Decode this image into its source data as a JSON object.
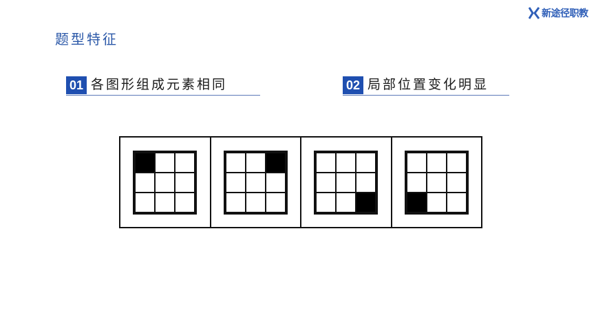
{
  "brand": {
    "logo_text": "新途径职教",
    "icon": "x-logo-icon",
    "color": "#2f5fb8"
  },
  "title": "题型特征",
  "points": [
    {
      "num": "01",
      "label": "各图形组成元素相同"
    },
    {
      "num": "02",
      "label": "局部位置变化明显"
    }
  ],
  "figures": [
    {
      "filled": [
        0
      ]
    },
    {
      "filled": [
        2
      ]
    },
    {
      "filled": [
        8
      ]
    },
    {
      "filled": [
        6
      ]
    }
  ],
  "colors": {
    "accent": "#1f4fb0",
    "title": "#2b58a8"
  }
}
